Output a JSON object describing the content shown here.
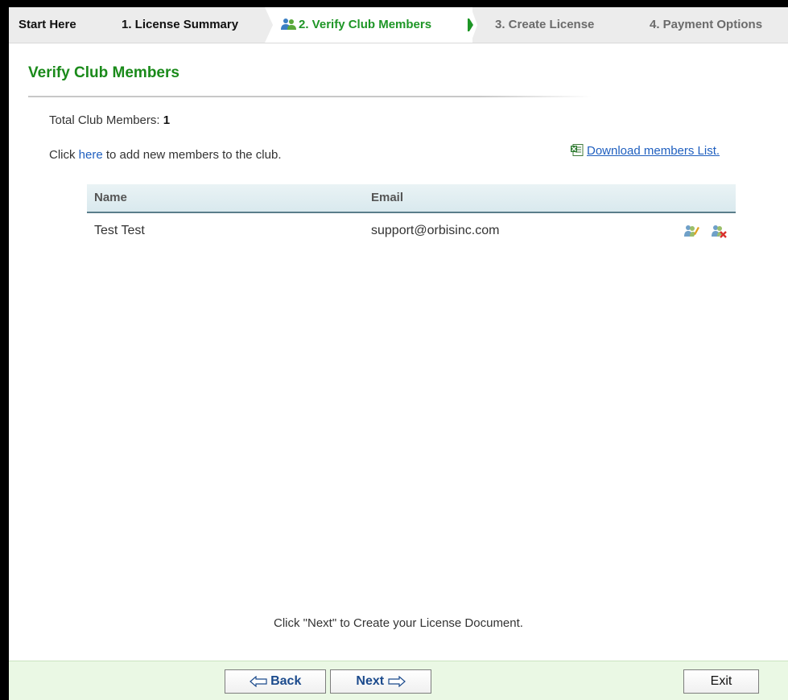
{
  "steps": [
    {
      "label": "Start Here",
      "state": "done"
    },
    {
      "label": "1. License Summary",
      "state": "done"
    },
    {
      "label": "2. Verify Club Members",
      "state": "active"
    },
    {
      "label": "3. Create License",
      "state": "future"
    },
    {
      "label": "4. Payment Options",
      "state": "future"
    }
  ],
  "page": {
    "title": "Verify Club Members",
    "total_label": "Total Club Members:",
    "total_value": "1",
    "add_prefix": "Click",
    "add_link": "here",
    "add_suffix": "to add new members to the club.",
    "download_label": "Download members List."
  },
  "table": {
    "columns": [
      "Name",
      "Email"
    ],
    "rows": [
      {
        "name": "Test Test",
        "email": "support@orbisinc.com"
      }
    ]
  },
  "footer_note": "Click \"Next\" to Create your License Document.",
  "buttons": {
    "back": "Back",
    "next": "Next",
    "exit": "Exit"
  },
  "colors": {
    "active_step": "#1e9626",
    "title": "#1a8a1a",
    "link": "#1f5fbf",
    "bottom_bar": "#eaf8e4"
  },
  "icons": {
    "active_step": "users-icon",
    "download": "excel-icon",
    "edit": "edit-user-icon",
    "delete": "delete-user-icon",
    "back": "arrow-left-icon",
    "next": "arrow-right-icon"
  }
}
